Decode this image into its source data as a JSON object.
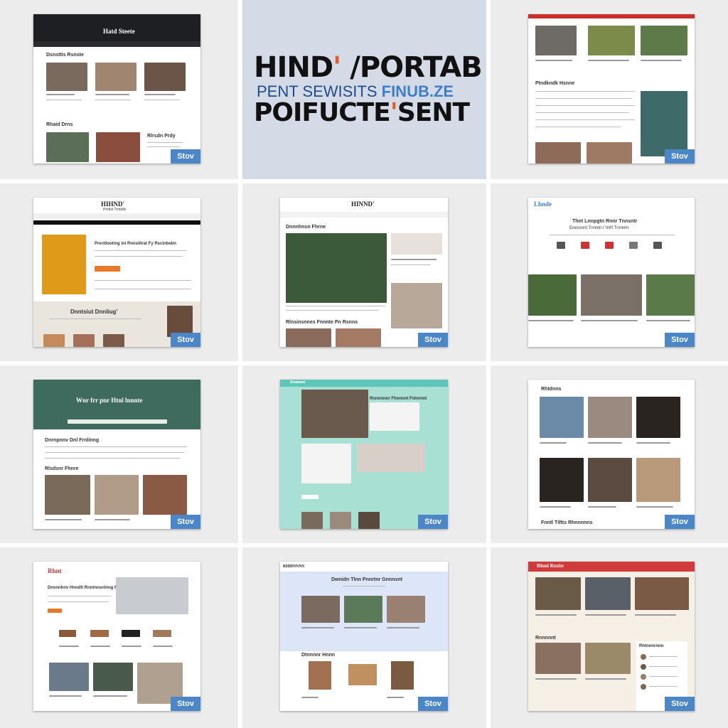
{
  "hero": {
    "line1_main": "HIND",
    "line1_accent": "'",
    "line1_rest": " /PORTAB &",
    "line2_a": "PENT SEWISITS ",
    "line2_b": "FINUB.ZE",
    "line3_main": "POIFUCTE",
    "line3_accent": "'",
    "line3_rest": "SENT"
  },
  "badge_label": "Stov",
  "tiles": {
    "t1": {
      "brand": "Hatd Steete",
      "heading": "Dsnsttis Rsnste",
      "section": "Rhaid Drns",
      "person": "Rlrsdn Prdy"
    },
    "t3": {
      "heading": "Ptndkndk Hsnne"
    },
    "t4": {
      "brand": "HIHND'",
      "subbrand": "Pnrtlst.Trmdds",
      "heading": "Pnrntlooting ini Rnnsiltrat Fy Rscinbebn",
      "section": "Dnntsiut Dnnliug'"
    },
    "t5": {
      "brand": "HINND'",
      "heading": "Dnnnhnsn Fhrne",
      "section": "Rlnsinsnnes Fnnnte Pn Rsnns"
    },
    "t6": {
      "brand": "Lhnde",
      "heading": "Thnt Lnnpgtn Rnnr Tnnsntr",
      "subheading": "Enessnnt Tnnntn l 'Infrl Tnrnnm"
    },
    "t7": {
      "banner": "Wnr frr pnr Htnl lnnnte",
      "heading": "Dnrnpnnv Dnl Frnlinng",
      "section": "Rlsdsnr Fhnre"
    },
    "t8": {
      "brand": "Rnnnmt",
      "heading": "Rnnnnnnr Fhnnnnt Fnlnrnnt"
    },
    "t9": {
      "heading": "Rhtdnns",
      "footer": "Fnntl Tiftts Rhnnnnns"
    },
    "t10": {
      "brand": "Rhnt",
      "heading": "Dnvnnhnv Hnndtl Rnntnnsnlnng Fnnt"
    },
    "t11": {
      "brand": "RHHNNNS",
      "heading": "Dwnidn Tlnn Pnnrtnr Gnnnsnt",
      "section": "Dtnnnnr Hnnn"
    },
    "t12": {
      "brand": "Rhnd Rnnhs",
      "section": "Rnnnnnt",
      "sidebar": "Rhtnnnrnnn"
    }
  }
}
